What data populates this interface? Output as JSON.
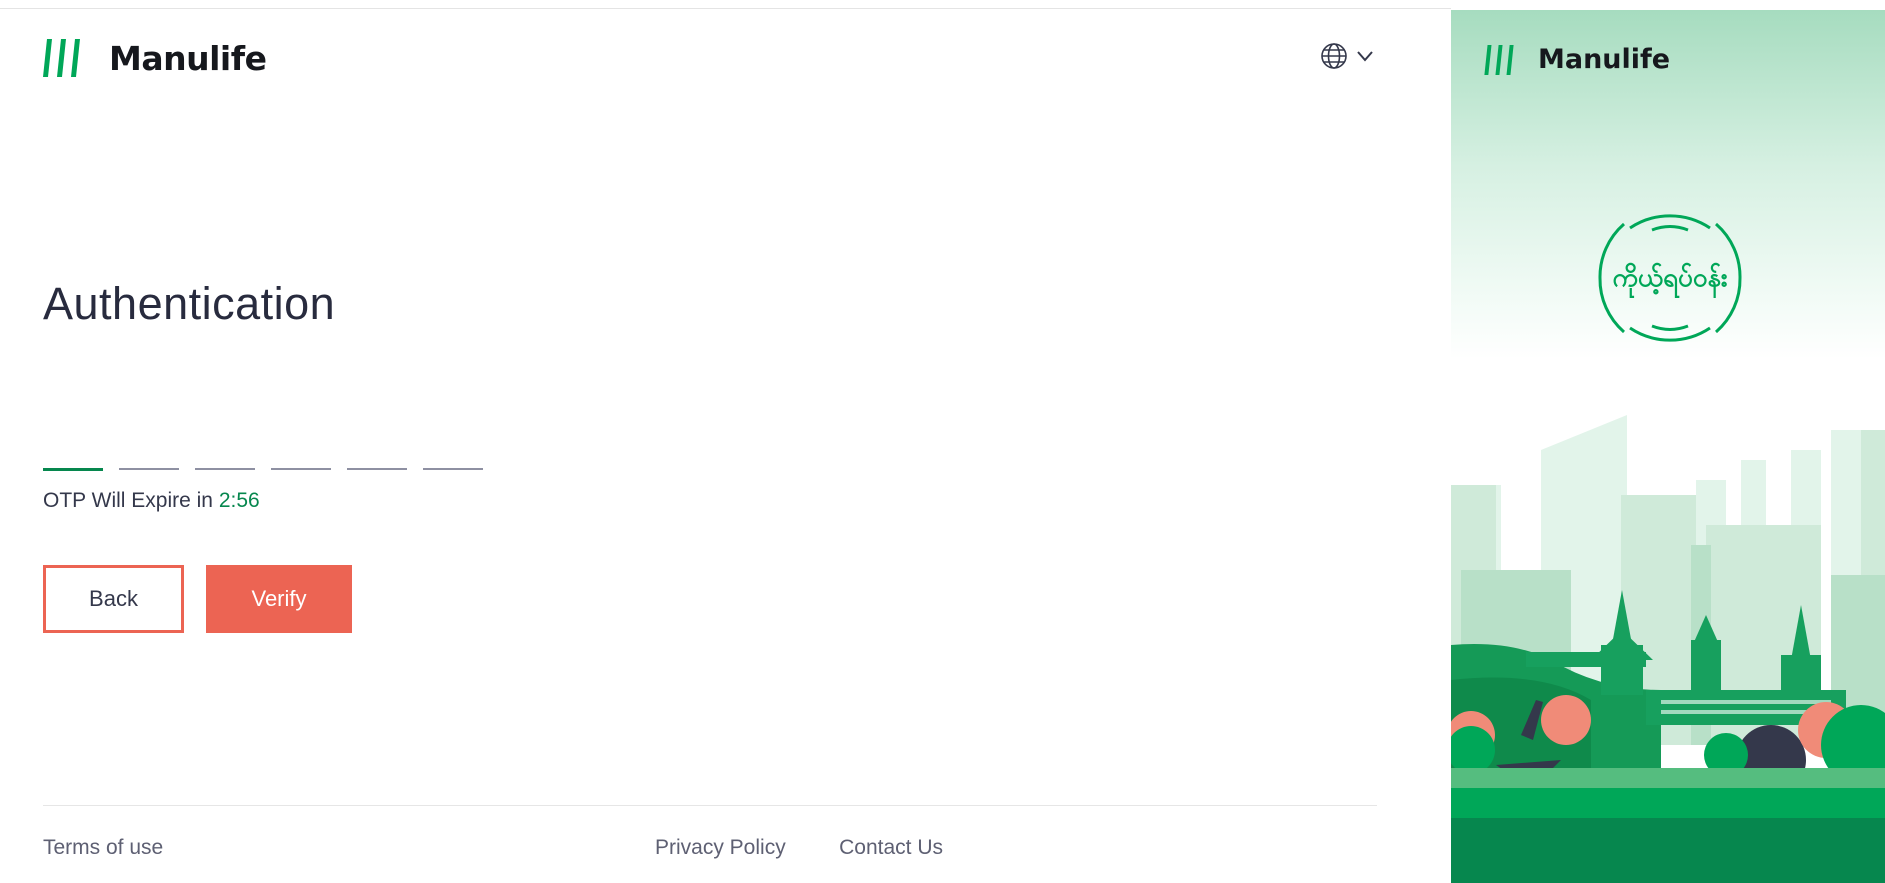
{
  "brand": {
    "name": "Manulife",
    "color": "#00a758"
  },
  "header": {
    "language_icon": "globe-icon",
    "dropdown_icon": "chevron-down-icon"
  },
  "page": {
    "title": "Authentication"
  },
  "otp": {
    "expire_label": "OTP Will Expire in",
    "expire_time": "2:56",
    "slots": 6,
    "active_slot": 1
  },
  "buttons": {
    "back_label": "Back",
    "verify_label": "Verify"
  },
  "footer": {
    "terms": "Terms of use",
    "privacy": "Privacy Policy",
    "contact": "Contact Us"
  },
  "side_panel": {
    "brand_name": "Manulife",
    "seal_text": "ကိုယ့်ရပ်ဝန်း"
  },
  "colors": {
    "accent_green": "#06874e",
    "button_coral": "#ec6453",
    "text_dark": "#282b3e"
  }
}
